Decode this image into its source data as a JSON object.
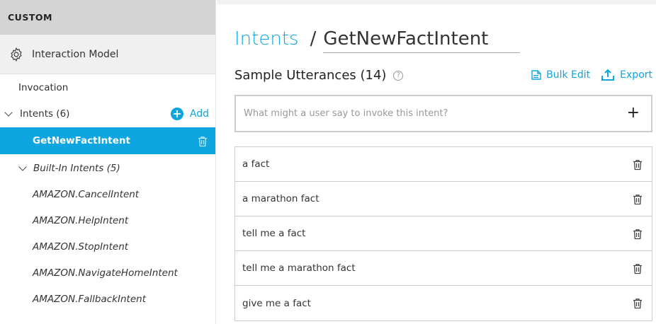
{
  "sidebar": {
    "header": "CUSTOM",
    "interaction_model": "Interaction Model",
    "invocation": "Invocation",
    "intents_label": "Intents (6)",
    "add_label": "Add",
    "selected_intent": "GetNewFactIntent",
    "builtin_label": "Built-In Intents (5)",
    "builtin_items": [
      "AMAZON.CancelIntent",
      "AMAZON.HelpIntent",
      "AMAZON.StopIntent",
      "AMAZON.NavigateHomeIntent",
      "AMAZON.FallbackIntent"
    ]
  },
  "main": {
    "breadcrumb_link": "Intents",
    "breadcrumb_sep": "/",
    "intent_name": "GetNewFactIntent",
    "section_title": "Sample Utterances (14)",
    "help_glyph": "?",
    "bulk_edit": "Bulk Edit",
    "export": "Export",
    "input_placeholder": "What might a user say to invoke this intent?",
    "plus_glyph": "+",
    "utterances": [
      "a fact",
      "a marathon fact",
      "tell me a fact",
      "tell me a marathon fact",
      "give me a fact"
    ]
  },
  "colors": {
    "accent": "#0ea5e0",
    "sidebar_header_bg": "#d4d4d4",
    "selected_bg": "#0ea5e0"
  }
}
